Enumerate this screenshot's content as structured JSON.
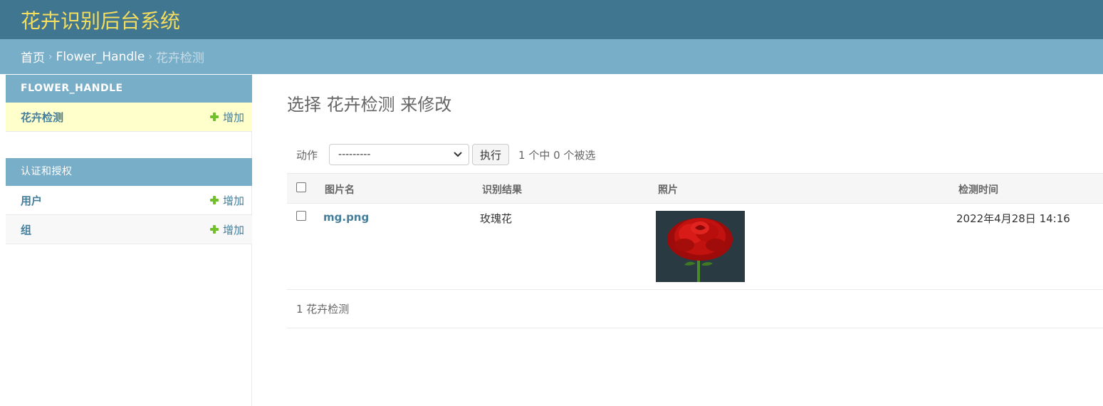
{
  "header": {
    "site_title": "花卉识别后台系统"
  },
  "breadcrumbs": {
    "home": "首页",
    "app": "Flower_Handle",
    "current": "花卉检测"
  },
  "sidebar": {
    "modules": [
      {
        "caption": "FLOWER_HANDLE",
        "rows": [
          {
            "label": "花卉检测",
            "add": "增加"
          }
        ]
      },
      {
        "caption": "认证和授权",
        "rows": [
          {
            "label": "用户",
            "add": "增加"
          },
          {
            "label": "组",
            "add": "增加"
          }
        ]
      }
    ]
  },
  "main": {
    "title": "选择 花卉检测 来修改",
    "actions": {
      "label": "动作",
      "select_value": "---------",
      "go": "执行",
      "counter": "1 个中 0 个被选"
    },
    "table": {
      "headers": [
        "图片名",
        "识别结果",
        "照片",
        "检测时间"
      ],
      "rows": [
        {
          "name": "mg.png",
          "result": "玫瑰花",
          "time": "2022年4月28日 14:16"
        }
      ]
    },
    "paginator": "1 花卉检测"
  },
  "colors": {
    "header_bg": "#417690",
    "title_yellow": "#f5dd5d",
    "breadcrumb_bg": "#79aec8",
    "link": "#447e9b",
    "add_green": "#70bf2b",
    "selected_row": "#ffffcc"
  },
  "icons": [
    "plus-icon",
    "chevron-down-icon",
    "checkbox"
  ]
}
